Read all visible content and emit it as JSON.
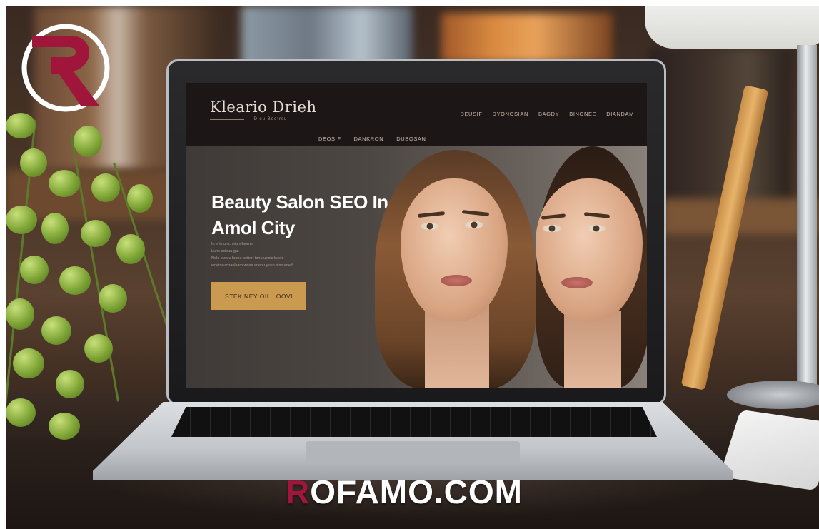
{
  "watermark": {
    "logo_letter": "R",
    "logo_icon": "r-circle-logo-icon",
    "site_prefix": "R",
    "site_rest": "OFAMO.COM",
    "brand_color": "#a0163a"
  },
  "website": {
    "logo": "Kleario Drieh",
    "logo_sub": "— Dieu Beetrsu",
    "nav": [
      "DEUSIF",
      "DYONOSIAN",
      "BAGDY",
      "BINONEE",
      "DIANDAM"
    ],
    "subnav": [
      "DEOSIF",
      "DANKRON",
      "DUBOSAN"
    ],
    "hero_title": "Beauty Salon SEO In Amol City",
    "hero_text": [
      "In ertinu scheip wlaerne",
      "Luns scieuu gat",
      "Nolo cuvuu lounu beiterf tonu ueoio baelo",
      "woetceuciraolsem wose anebu yuuo elsn adeif"
    ],
    "cta": "STEK NEY OIL LOOVI",
    "accent": "#c99a4f"
  }
}
